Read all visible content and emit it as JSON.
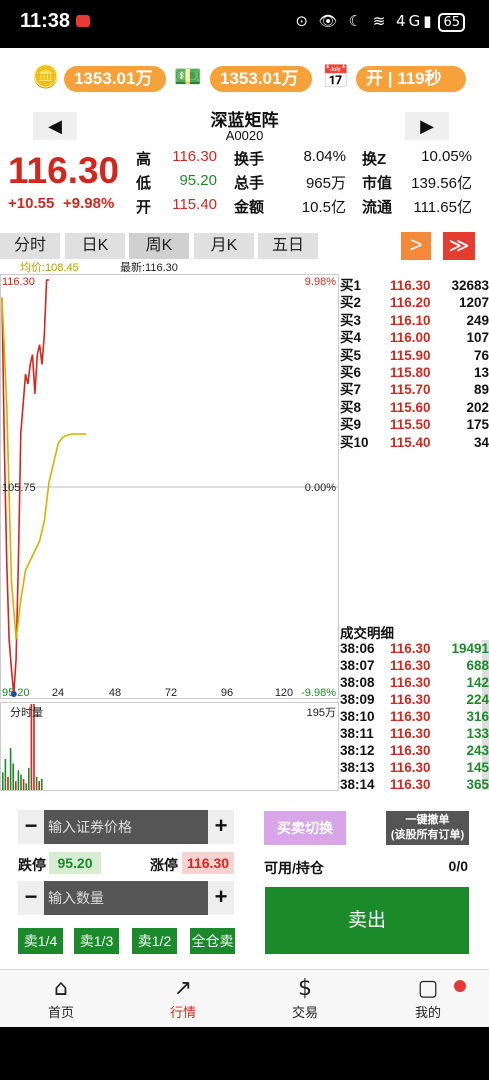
{
  "status_bar": {
    "time": "11:38",
    "icons": "⊙ 👁 ☾ ≋ 4G▮",
    "battery": "65"
  },
  "header": {
    "balance1": "1353.01万",
    "balance2": "1353.01万",
    "market_status": "开 | 119秒",
    "stock_name": "深蓝矩阵",
    "stock_code": "A0020",
    "prev_symbol": "◀",
    "next_symbol": "▶"
  },
  "quote": {
    "price": "116.30",
    "change": "+10.55",
    "change_pct": "+9.98%",
    "stats": [
      {
        "l1": "高",
        "v1": "116.30",
        "c1": "red",
        "l2": "换手",
        "v2": "8.04%",
        "l3": "换Z",
        "v3": "10.05%"
      },
      {
        "l1": "低",
        "v1": "95.20",
        "c1": "green",
        "l2": "总手",
        "v2": "965万",
        "l3": "市值",
        "v3": "139.56亿"
      },
      {
        "l1": "开",
        "v1": "115.40",
        "c1": "red",
        "l2": "金额",
        "v2": "10.5亿",
        "l3": "流通",
        "v3": "111.65亿"
      }
    ]
  },
  "tabs": [
    "分时",
    "日K",
    "周K",
    "月K",
    "五日"
  ],
  "buttons": {
    "next": ">",
    "fast": "≫"
  },
  "chart_labels": {
    "avg": "均价:108.45",
    "latest": "最新:116.30",
    "top_price": "116.30",
    "top_pct": "9.98%",
    "mid_price": "105.75",
    "mid_pct": "0.00%",
    "bottom_price": "95.20",
    "bottom_pct": "-9.98%",
    "x_ticks": [
      "24",
      "48",
      "72",
      "96",
      "120"
    ],
    "volume_label": "分时量",
    "volume_max": "195万"
  },
  "chart_data": {
    "type": "line",
    "ylim": [
      95.2,
      116.3
    ],
    "series": [
      {
        "name": "最新",
        "color": "#d0281e",
        "x": [
          0,
          1,
          2,
          3,
          4,
          5,
          6,
          7,
          8,
          9,
          10,
          11,
          12,
          13,
          14,
          15,
          16,
          17,
          18,
          19,
          20
        ],
        "y": [
          115.4,
          108.0,
          102.0,
          98.0,
          96.5,
          95.2,
          97.0,
          102.0,
          108.5,
          110.0,
          111.5,
          111.0,
          112.0,
          112.5,
          110.5,
          112.5,
          113.0,
          112.0,
          113.5,
          116.3,
          116.3
        ]
      },
      {
        "name": "均价",
        "color": "#d4b100",
        "x": [
          0,
          2,
          4,
          6,
          8,
          10,
          12,
          14,
          16,
          18,
          20,
          21,
          22,
          24,
          26,
          28,
          30,
          32,
          34,
          36
        ],
        "y": [
          115.4,
          110.0,
          101.0,
          98.0,
          100.0,
          101.5,
          102.0,
          102.5,
          103.0,
          104.0,
          106.0,
          106.5,
          107.0,
          108.0,
          108.3,
          108.4,
          108.45,
          108.45,
          108.45,
          108.45
        ]
      }
    ],
    "volume": [
      40,
      70,
      30,
      95,
      60,
      20,
      45,
      35,
      25,
      15,
      50,
      195,
      195,
      30,
      20,
      25
    ]
  },
  "order_book": [
    {
      "label": "买1",
      "price": "116.30",
      "qty": "32683"
    },
    {
      "label": "买2",
      "price": "116.20",
      "qty": "1207"
    },
    {
      "label": "买3",
      "price": "116.10",
      "qty": "249"
    },
    {
      "label": "买4",
      "price": "116.00",
      "qty": "107"
    },
    {
      "label": "买5",
      "price": "115.90",
      "qty": "76"
    },
    {
      "label": "买6",
      "price": "115.80",
      "qty": "13"
    },
    {
      "label": "买7",
      "price": "115.70",
      "qty": "89"
    },
    {
      "label": "买8",
      "price": "115.60",
      "qty": "202"
    },
    {
      "label": "买9",
      "price": "115.50",
      "qty": "175"
    },
    {
      "label": "买10",
      "price": "115.40",
      "qty": "34"
    }
  ],
  "trades_title": "成交明细",
  "trades": [
    {
      "time": "38:06",
      "price": "116.30",
      "qty": "19491"
    },
    {
      "time": "38:07",
      "price": "116.30",
      "qty": "688"
    },
    {
      "time": "38:08",
      "price": "116.30",
      "qty": "142"
    },
    {
      "time": "38:09",
      "price": "116.30",
      "qty": "224"
    },
    {
      "time": "38:10",
      "price": "116.30",
      "qty": "316"
    },
    {
      "time": "38:11",
      "price": "116.30",
      "qty": "133"
    },
    {
      "time": "38:12",
      "price": "116.30",
      "qty": "243"
    },
    {
      "time": "38:13",
      "price": "116.30",
      "qty": "145"
    },
    {
      "time": "38:14",
      "price": "116.30",
      "qty": "365"
    }
  ],
  "trade_panel": {
    "price_placeholder": "输入证券价格",
    "qty_placeholder": "输入数量",
    "minus": "−",
    "plus": "+",
    "limit_down_label": "跌停",
    "limit_down": "95.20",
    "limit_up_label": "涨停",
    "limit_up": "116.30",
    "switch_label": "买卖切换",
    "cancel_all_line1": "一键撤单",
    "cancel_all_line2": "(该股所有订单)",
    "available_label": "可用/持仓",
    "available_value": "0/0",
    "sell_label": "卖出",
    "quick": [
      "卖1/4",
      "卖1/3",
      "卖1/2",
      "全仓卖"
    ]
  },
  "tab_bar": [
    {
      "label": "首页",
      "icon": "home-icon",
      "glyph": "⌂"
    },
    {
      "label": "行情",
      "icon": "trend-chart-icon",
      "glyph": "↗"
    },
    {
      "label": "交易",
      "icon": "exchange-icon",
      "glyph": "$"
    },
    {
      "label": "我的",
      "icon": "profile-icon",
      "glyph": "▢"
    }
  ],
  "colors": {
    "up": "#d0281e",
    "down": "#1a8a2a",
    "accent": "#f6a13a"
  }
}
